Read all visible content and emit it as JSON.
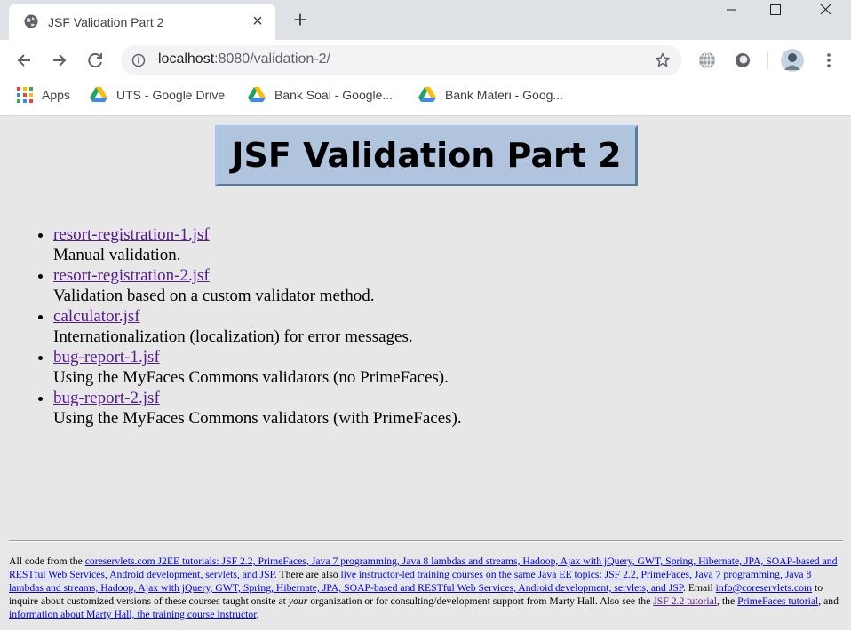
{
  "browser": {
    "tab_title": "JSF Validation Part 2",
    "url_host": "localhost",
    "url_path": ":8080/validation-2/",
    "bookmarks": [
      {
        "label": "Apps",
        "icon": "apps-grid-icon"
      },
      {
        "label": "UTS - Google Drive",
        "icon": "google-drive-icon"
      },
      {
        "label": "Bank Soal - Google...",
        "icon": "google-drive-icon"
      },
      {
        "label": "Bank Materi - Goog...",
        "icon": "google-drive-icon"
      }
    ]
  },
  "page": {
    "title": "JSF Validation Part 2",
    "items": [
      {
        "link": "resort-registration-1.jsf",
        "desc": "Manual validation."
      },
      {
        "link": "resort-registration-2.jsf",
        "desc": "Validation based on a custom validator method."
      },
      {
        "link": "calculator.jsf",
        "desc": "Internationalization (localization) for error messages."
      },
      {
        "link": "bug-report-1.jsf",
        "desc": "Using the MyFaces Commons validators (no PrimeFaces)."
      },
      {
        "link": "bug-report-2.jsf",
        "desc": "Using the MyFaces Commons validators (with PrimeFaces)."
      }
    ]
  },
  "footer": {
    "t1": "All code from the ",
    "l1": "coreservlets.com J2EE tutorials: JSF 2.2, PrimeFaces, Java 7 programming, Java 8 lambdas and streams, Hadoop, Ajax with jQuery, GWT, Spring, Hibernate, JPA, SOAP-based and RESTful Web Services, Android development, servlets, and JSP",
    "t2": ". There are also ",
    "l2": "live instructor-led training courses on the same Java EE topics: JSF 2.2, PrimeFaces, Java 7 programming, Java 8 lambdas and streams, Hadoop, Ajax with jQuery, GWT, Spring, Hibernate, JPA, SOAP-based and RESTful Web Services, Android development, servlets, and JSP",
    "t3": ". Email ",
    "l3": "info@coreservlets.com",
    "t4": " to inquire about customized versions of these courses taught onsite at ",
    "t4_em": "your",
    "t5": " organization or for consulting/development support from Marty Hall. Also see the ",
    "l4": "JSF 2.2 tutorial",
    "t6": ", the ",
    "l5": "PrimeFaces tutorial",
    "t7": ", and ",
    "l6": "information about Marty Hall, the training course instructor",
    "t8": "."
  },
  "colors": {
    "link": "#551a8b",
    "footer_link": "#0000ee",
    "title_bg": "#b0c4de",
    "page_bg": "#e7e7e7"
  }
}
